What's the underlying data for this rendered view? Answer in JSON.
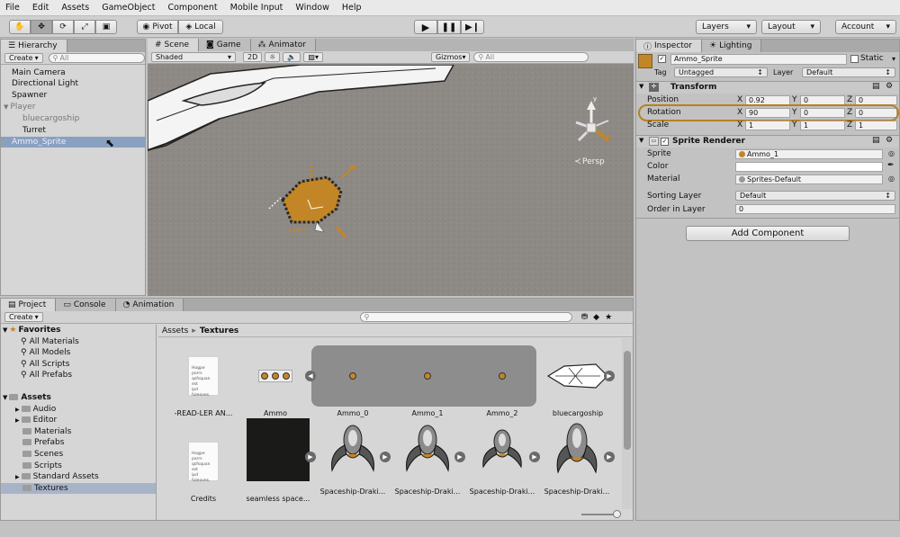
{
  "menu": [
    "File",
    "Edit",
    "Assets",
    "GameObject",
    "Component",
    "Mobile Input",
    "Window",
    "Help"
  ],
  "toolbar": {
    "pivot": "Pivot",
    "local": "Local",
    "layers": "Layers",
    "layout": "Layout",
    "account": "Account"
  },
  "hierarchy": {
    "tab": "Hierarchy",
    "create": "Create",
    "search": "All",
    "items": [
      "Main Camera",
      "Directional Light",
      "Spawner",
      "Player",
      "bluecargoship",
      "Turret",
      "Ammo_Sprite"
    ]
  },
  "scene": {
    "tabs": [
      "Scene",
      "Game",
      "Animator"
    ],
    "shading": "Shaded",
    "mode2d": "2D",
    "gizmos": "Gizmos",
    "search": "All",
    "persp": "Persp"
  },
  "inspector": {
    "tabs": [
      "Inspector",
      "Lighting"
    ],
    "name": "Ammo_Sprite",
    "static": "Static",
    "tag_label": "Tag",
    "tag": "Untagged",
    "layer_label": "Layer",
    "layer": "Default",
    "transform": {
      "title": "Transform",
      "position": {
        "label": "Position",
        "x": "0.92",
        "y": "0",
        "z": "0"
      },
      "rotation": {
        "label": "Rotation",
        "x": "90",
        "y": "0",
        "z": "0"
      },
      "scale": {
        "label": "Scale",
        "x": "1",
        "y": "1",
        "z": "1"
      }
    },
    "sprite_renderer": {
      "title": "Sprite Renderer",
      "sprite_label": "Sprite",
      "sprite": "Ammo_1",
      "color_label": "Color",
      "material_label": "Material",
      "material": "Sprites-Default",
      "sorting_label": "Sorting Layer",
      "sorting": "Default",
      "order_label": "Order in Layer",
      "order": "0"
    },
    "add_component": "Add Component",
    "axes": {
      "x": "X",
      "y": "Y",
      "z": "Z"
    }
  },
  "project": {
    "tabs": [
      "Project",
      "Console",
      "Animation"
    ],
    "create": "Create",
    "favorites": {
      "title": "Favorites",
      "items": [
        "All Materials",
        "All Models",
        "All Scripts",
        "All Prefabs"
      ]
    },
    "assets": {
      "title": "Assets",
      "items": [
        "Audio",
        "Editor",
        "Materials",
        "Prefabs",
        "Scenes",
        "Scripts",
        "Standard Assets",
        "Textures"
      ]
    },
    "breadcrumb": {
      "root": "Assets",
      "sep": "▸",
      "current": "Textures"
    },
    "grid": [
      "-READ-LER AN...",
      "Ammo",
      "Ammo_0",
      "Ammo_1",
      "Ammo_2",
      "bluecargoship",
      "Credits",
      "seamless space...",
      "Spaceship-Draki...",
      "Spaceship-Draki...",
      "Spaceship-Draki...",
      "Spaceship-Draki..."
    ],
    "doc_lines": [
      "Hogpe porrs",
      "qsfsquan est",
      "ipd fuleoves."
    ]
  },
  "colors": {
    "accent": "#c0882e",
    "selected": "#8aa0c0",
    "orange_ring": "#b8801f"
  }
}
